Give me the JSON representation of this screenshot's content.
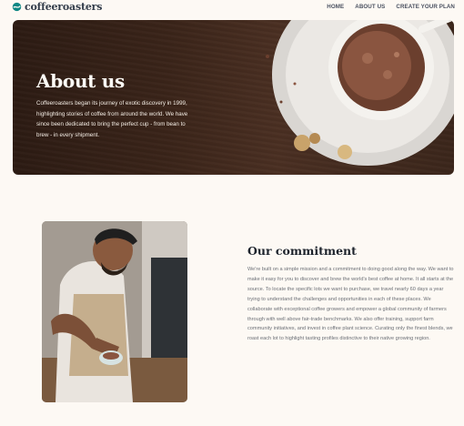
{
  "header": {
    "logo_text": "coffeeroasters",
    "nav": [
      "HOME",
      "ABOUT US",
      "CREATE YOUR PLAN"
    ]
  },
  "hero": {
    "title": "About us",
    "text": "Coffeeroasters began its journey of exotic discovery in 1999, highlighting stories of coffee from around the world. We have since been dedicated to bring the perfect cup - from bean to brew - in every shipment."
  },
  "commitment": {
    "title": "Our commitment",
    "text": "We're built on a simple mission and a commitment to doing good along the way. We want to make it easy for you to discover and brew the world's best coffee at home. It all starts at the source. To locate the specific lots we want to purchase, we travel nearly 60 days a year trying to understand the challenges and opportunities in each of these places. We collaborate with exceptional coffee growers and empower a global community of farmers through with well above fair-trade benchmarks. We also offer training, support farm community initiatives, and invest in coffee plant science. Curating only the finest blends, we roast each lot to highlight tasting profiles distinctive to their native growing region."
  },
  "colors": {
    "background": "#fdf9f4",
    "logo_accent": "#0e8784",
    "heading": "#333d4b"
  },
  "icons": [
    "logo-coffee-bean-icon"
  ]
}
